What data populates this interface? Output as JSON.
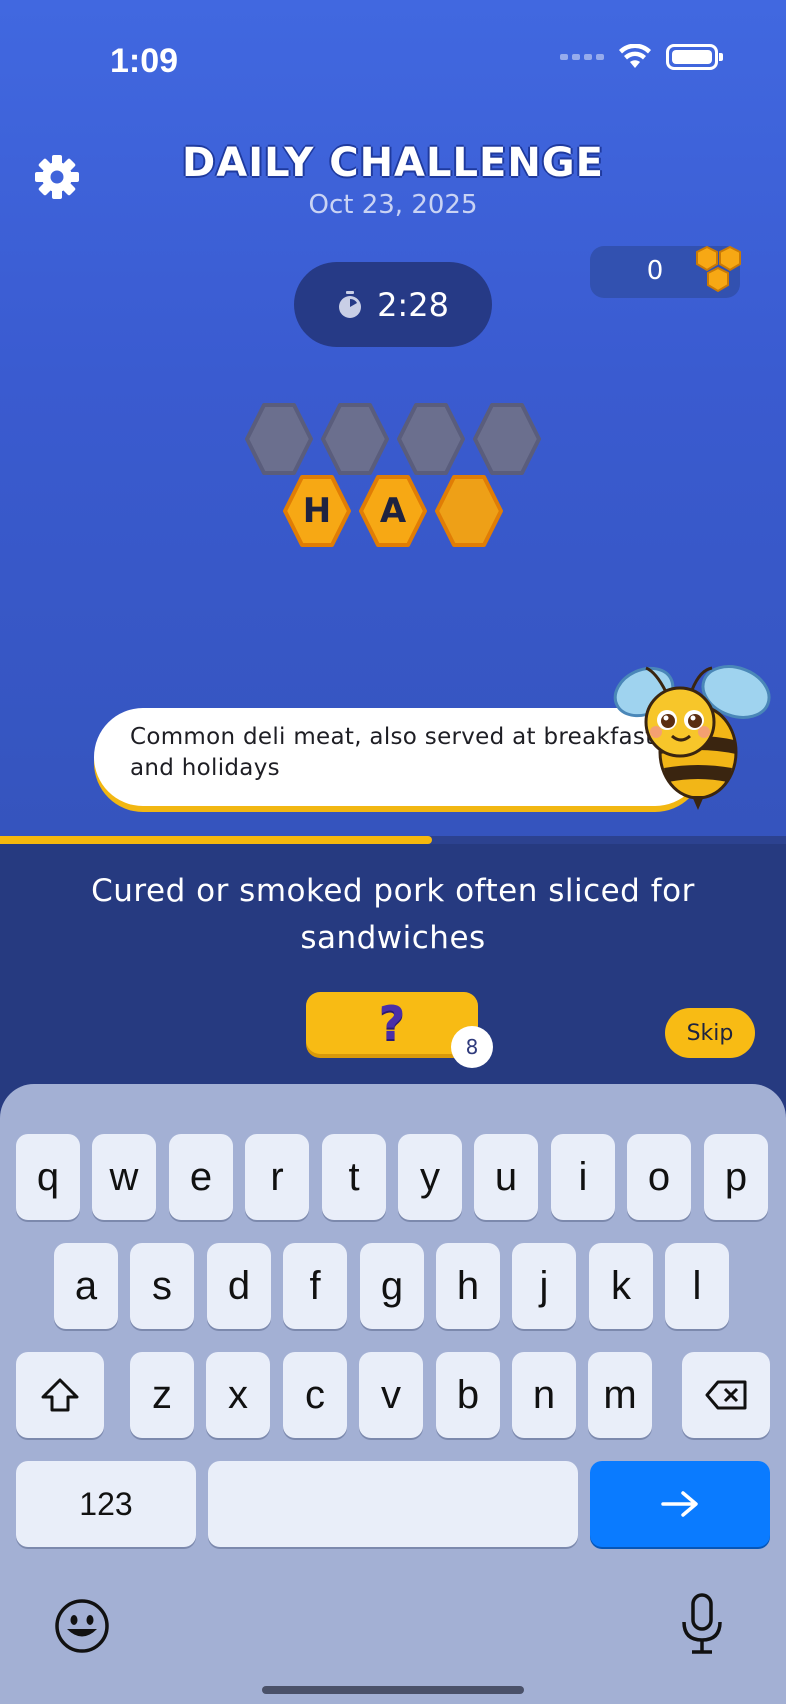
{
  "status_bar": {
    "time": "1:09"
  },
  "header": {
    "title": "DAILY CHALLENGE",
    "date": "Oct 23, 2025"
  },
  "honey": {
    "count": "0"
  },
  "timer": {
    "value": "2:28"
  },
  "word": {
    "row1": [
      "",
      "",
      "",
      ""
    ],
    "row2": [
      "H",
      "A",
      ""
    ]
  },
  "clue": {
    "text": "Common deli meat, also served at breakfasts and holidays"
  },
  "progress": {
    "fraction": 0.55
  },
  "question": {
    "text": "Cured or smoked pork often sliced for sandwiches"
  },
  "hint": {
    "label": "?",
    "count": "8"
  },
  "skip": {
    "label": "Skip"
  },
  "keyboard": {
    "row1": [
      "q",
      "w",
      "e",
      "r",
      "t",
      "y",
      "u",
      "i",
      "o",
      "p"
    ],
    "row2": [
      "a",
      "s",
      "d",
      "f",
      "g",
      "h",
      "j",
      "k",
      "l"
    ],
    "row3": [
      "z",
      "x",
      "c",
      "v",
      "b",
      "n",
      "m"
    ],
    "numbers_label": "123"
  },
  "colors": {
    "accent": "#f8bb14",
    "background": "#3a5bd0",
    "go_key": "#0a7bff"
  }
}
